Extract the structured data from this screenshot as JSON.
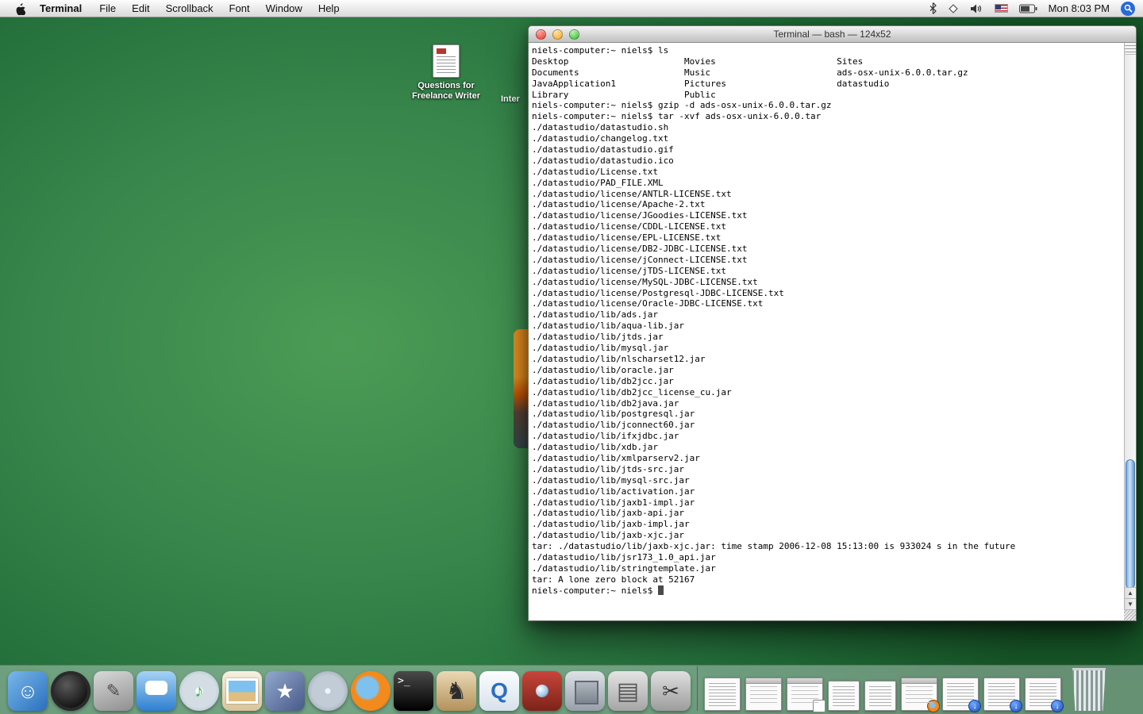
{
  "menubar": {
    "menus": [
      "Terminal",
      "File",
      "Edit",
      "Scrollback",
      "Font",
      "Window",
      "Help"
    ],
    "clock": "Mon 8:03 PM"
  },
  "desktop": {
    "icon_questions": {
      "line1": "Questions for",
      "line2": "Freelance Writer"
    },
    "partial_label": "Inter"
  },
  "terminal": {
    "title": "Terminal — bash — 124x52",
    "lines": [
      "niels-computer:~ niels$ ls",
      "Desktop                      Movies                       Sites",
      "Documents                    Music                        ads-osx-unix-6.0.0.tar.gz",
      "JavaApplication1             Pictures                     datastudio",
      "Library                      Public",
      "niels-computer:~ niels$ gzip -d ads-osx-unix-6.0.0.tar.gz",
      "niels-computer:~ niels$ tar -xvf ads-osx-unix-6.0.0.tar",
      "./datastudio/datastudio.sh",
      "./datastudio/changelog.txt",
      "./datastudio/datastudio.gif",
      "./datastudio/datastudio.ico",
      "./datastudio/License.txt",
      "./datastudio/PAD_FILE.XML",
      "./datastudio/license/ANTLR-LICENSE.txt",
      "./datastudio/license/Apache-2.txt",
      "./datastudio/license/JGoodies-LICENSE.txt",
      "./datastudio/license/CDDL-LICENSE.txt",
      "./datastudio/license/EPL-LICENSE.txt",
      "./datastudio/license/DB2-JDBC-LICENSE.txt",
      "./datastudio/license/jConnect-LICENSE.txt",
      "./datastudio/license/jTDS-LICENSE.txt",
      "./datastudio/license/MySQL-JDBC-LICENSE.txt",
      "./datastudio/license/Postgresql-JDBC-LICENSE.txt",
      "./datastudio/license/Oracle-JDBC-LICENSE.txt",
      "./datastudio/lib/ads.jar",
      "./datastudio/lib/aqua-lib.jar",
      "./datastudio/lib/jtds.jar",
      "./datastudio/lib/mysql.jar",
      "./datastudio/lib/nlscharset12.jar",
      "./datastudio/lib/oracle.jar",
      "./datastudio/lib/db2jcc.jar",
      "./datastudio/lib/db2jcc_license_cu.jar",
      "./datastudio/lib/db2java.jar",
      "./datastudio/lib/postgresql.jar",
      "./datastudio/lib/jconnect60.jar",
      "./datastudio/lib/ifxjdbc.jar",
      "./datastudio/lib/xdb.jar",
      "./datastudio/lib/xmlparserv2.jar",
      "./datastudio/lib/jtds-src.jar",
      "./datastudio/lib/mysql-src.jar",
      "./datastudio/lib/activation.jar",
      "./datastudio/lib/jaxb1-impl.jar",
      "./datastudio/lib/jaxb-api.jar",
      "./datastudio/lib/jaxb-impl.jar",
      "./datastudio/lib/jaxb-xjc.jar",
      "tar: ./datastudio/lib/jaxb-xjc.jar: time stamp 2006-12-08 15:13:00 is 933024 s in the future",
      "./datastudio/lib/jsr173_1.0_api.jar",
      "./datastudio/lib/stringtemplate.jar",
      "tar: A lone zero block at 52167",
      "niels-computer:~ niels$ "
    ]
  },
  "dock": {
    "apps": [
      {
        "id": "finder",
        "glyph": "☺"
      },
      {
        "id": "dashboard",
        "glyph": ""
      },
      {
        "id": "stickies",
        "glyph": "✎"
      },
      {
        "id": "ichat",
        "glyph": ""
      },
      {
        "id": "itunes",
        "glyph": "♪"
      },
      {
        "id": "iphoto",
        "glyph": ""
      },
      {
        "id": "imovie",
        "glyph": "★"
      },
      {
        "id": "dvdplayer",
        "glyph": ""
      },
      {
        "id": "firefox",
        "glyph": ""
      },
      {
        "id": "terminal-app",
        "glyph": ">_"
      },
      {
        "id": "chess",
        "glyph": "♞"
      },
      {
        "id": "quicktime",
        "glyph": "Q"
      },
      {
        "id": "photobooth",
        "glyph": ""
      },
      {
        "id": "vault",
        "glyph": ""
      },
      {
        "id": "cabinet",
        "glyph": "▤"
      },
      {
        "id": "grab",
        "glyph": "✂"
      }
    ],
    "minimized": [
      {
        "kind": "doc",
        "name": "minimized-document-1",
        "badge": ""
      },
      {
        "kind": "win",
        "name": "minimized-window-1",
        "badge": ""
      },
      {
        "kind": "win",
        "name": "minimized-window-2",
        "badge": "doc"
      },
      {
        "kind": "doc small",
        "name": "minimized-document-2",
        "badge": ""
      },
      {
        "kind": "doc small",
        "name": "minimized-document-3",
        "badge": ""
      },
      {
        "kind": "win",
        "name": "minimized-firefox-window",
        "badge": "firefox"
      },
      {
        "kind": "doc",
        "name": "minimized-document-4",
        "badge": "download"
      },
      {
        "kind": "doc",
        "name": "minimized-document-5",
        "badge": "download"
      },
      {
        "kind": "doc",
        "name": "minimized-document-6",
        "badge": "download"
      }
    ],
    "download_badge_glyph": "↓"
  }
}
